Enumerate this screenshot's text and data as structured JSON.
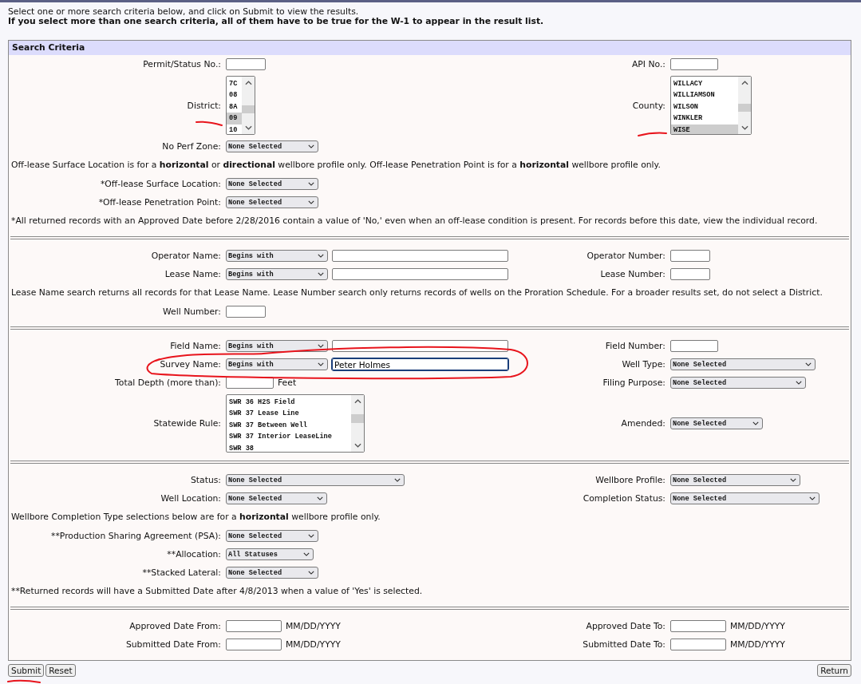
{
  "intro": {
    "text": "Select one or more search criteria below, and click on Submit to view the results.",
    "warning": "If you select more than one search criteria, all of them have to be true for the W-1 to appear in the result list."
  },
  "panel": {
    "title": "Search Criteria"
  },
  "sections": [
    {
      "rows": [
        {
          "kind": "fields",
          "left": {
            "label": "Permit/Status No.:",
            "control": {
              "kind": "text"
            }
          },
          "right": {
            "label": "API No.:",
            "control": {
              "kind": "text"
            }
          }
        },
        {
          "kind": "fields",
          "left": {
            "label": "District:",
            "control": {
              "kind": "listbox",
              "options": [
                {
                  "text": "7C",
                  "selected": false
                },
                {
                  "text": "08",
                  "selected": false
                },
                {
                  "text": "8A",
                  "selected": false
                },
                {
                  "text": "09",
                  "selected": true
                },
                {
                  "text": "10",
                  "selected": false
                }
              ]
            }
          },
          "right": {
            "label": "County:",
            "control": {
              "kind": "listbox",
              "options": [
                {
                  "text": "WILLACY",
                  "selected": false
                },
                {
                  "text": "WILLIAMSON",
                  "selected": false
                },
                {
                  "text": "WILSON",
                  "selected": false
                },
                {
                  "text": "WINKLER",
                  "selected": false
                },
                {
                  "text": "WISE",
                  "selected": true
                }
              ]
            }
          }
        },
        {
          "kind": "fields",
          "left": {
            "label": "No Perf Zone:",
            "control": {
              "kind": "select",
              "value": "None Selected"
            }
          }
        },
        {
          "kind": "note",
          "text": "Off-lease Surface Location is for a **horizontal** or **directional** wellbore profile only. Off-lease Penetration Point is for a **horizontal** wellbore profile only."
        },
        {
          "kind": "fields",
          "left": {
            "label": "*Off-lease Surface Location:",
            "control": {
              "kind": "select",
              "value": "None Selected"
            }
          }
        },
        {
          "kind": "fields",
          "left": {
            "label": "*Off-lease Penetration Point:",
            "control": {
              "kind": "select",
              "value": "None Selected"
            }
          }
        },
        {
          "kind": "note",
          "text": "*All returned records with an Approved Date before 2/28/2016 contain a value of 'No,' even when an off-lease condition is present. For records before this date, view the individual record."
        }
      ]
    },
    {
      "rows": [
        {
          "kind": "fields",
          "left": {
            "label": "Operator Name:",
            "control": {
              "kind": "match-text",
              "match": "Begins with"
            }
          },
          "right": {
            "label": "Operator Number:",
            "control": {
              "kind": "text"
            }
          }
        },
        {
          "kind": "fields",
          "left": {
            "label": "Lease Name:",
            "control": {
              "kind": "match-text",
              "match": "Begins with"
            }
          },
          "right": {
            "label": "Lease Number:",
            "control": {
              "kind": "text"
            }
          }
        },
        {
          "kind": "note",
          "text": "Lease Name search returns all records for that Lease Name. Lease Number search only returns records of wells on the Proration Schedule. For a broader results set, do not select a District."
        },
        {
          "kind": "fields",
          "left": {
            "label": "Well Number:",
            "control": {
              "kind": "text"
            }
          }
        }
      ]
    },
    {
      "rows": [
        {
          "kind": "fields",
          "left": {
            "label": "Field Name:",
            "control": {
              "kind": "match-text",
              "match": "Begins with"
            }
          },
          "right": {
            "label": "Field Number:",
            "control": {
              "kind": "text"
            }
          }
        },
        {
          "kind": "fields",
          "left": {
            "label": "Survey Name:",
            "control": {
              "kind": "match-text",
              "match": "Begins with",
              "value": "Peter Holmes",
              "focused": true
            }
          },
          "right": {
            "label": "Well Type:",
            "control": {
              "kind": "select",
              "value": "None Selected"
            }
          }
        },
        {
          "kind": "fields",
          "left": {
            "label": "Total Depth (more than):",
            "control": {
              "kind": "text"
            },
            "suffix": "Feet"
          },
          "right": {
            "label": "Filing Purpose:",
            "control": {
              "kind": "select",
              "value": "None Selected"
            }
          }
        },
        {
          "kind": "fields",
          "left": {
            "label": "Statewide Rule:",
            "control": {
              "kind": "listbox",
              "options": [
                {
                  "text": "SWR 36 H2S Field",
                  "selected": false
                },
                {
                  "text": "SWR 37 Lease Line",
                  "selected": false
                },
                {
                  "text": "SWR 37 Between Well",
                  "selected": false
                },
                {
                  "text": "SWR 37 Interior LeaseLine",
                  "selected": false
                },
                {
                  "text": "SWR 38",
                  "selected": false
                }
              ]
            }
          },
          "right": {
            "label": "Amended:",
            "control": {
              "kind": "select",
              "value": "None Selected"
            }
          }
        }
      ]
    },
    {
      "rows": [
        {
          "kind": "fields",
          "left": {
            "label": "Status:",
            "control": {
              "kind": "select",
              "value": "None Selected"
            }
          },
          "right": {
            "label": "Wellbore Profile:",
            "control": {
              "kind": "select",
              "value": "None Selected"
            }
          }
        },
        {
          "kind": "fields",
          "left": {
            "label": "Well Location:",
            "control": {
              "kind": "select",
              "value": "None Selected"
            }
          },
          "right": {
            "label": "Completion Status:",
            "control": {
              "kind": "select",
              "value": "None Selected"
            }
          }
        },
        {
          "kind": "note",
          "text": "Wellbore Completion Type selections below are for a **horizontal** wellbore profile only."
        },
        {
          "kind": "fields",
          "left": {
            "label": "**Production Sharing Agreement (PSA):",
            "control": {
              "kind": "select",
              "value": "None Selected"
            }
          }
        },
        {
          "kind": "fields",
          "left": {
            "label": "**Allocation:",
            "control": {
              "kind": "select",
              "value": "All Statuses"
            }
          }
        },
        {
          "kind": "fields",
          "left": {
            "label": "**Stacked Lateral:",
            "control": {
              "kind": "select",
              "value": "None Selected"
            }
          }
        },
        {
          "kind": "note",
          "text": "**Returned records will have a Submitted Date after 4/8/2013 when a value of 'Yes' is selected."
        }
      ]
    },
    {
      "rows": [
        {
          "kind": "fields",
          "left": {
            "label": "Approved Date From:",
            "control": {
              "kind": "text"
            },
            "suffix": "MM/DD/YYYY"
          },
          "right": {
            "label": "Approved Date To:",
            "control": {
              "kind": "text"
            },
            "suffix": "MM/DD/YYYY"
          }
        },
        {
          "kind": "fields",
          "left": {
            "label": "Submitted Date From:",
            "control": {
              "kind": "text"
            },
            "suffix": "MM/DD/YYYY"
          },
          "right": {
            "label": "Submitted Date To:",
            "control": {
              "kind": "text"
            },
            "suffix": "MM/DD/YYYY"
          }
        }
      ]
    }
  ],
  "buttons": {
    "left": [
      "Submit",
      "Reset"
    ],
    "right": [
      "Return"
    ]
  },
  "annotations": [
    {
      "kind": "underline"
    },
    {
      "kind": "underline"
    },
    {
      "kind": "ellipse"
    },
    {
      "kind": "underline"
    }
  ]
}
